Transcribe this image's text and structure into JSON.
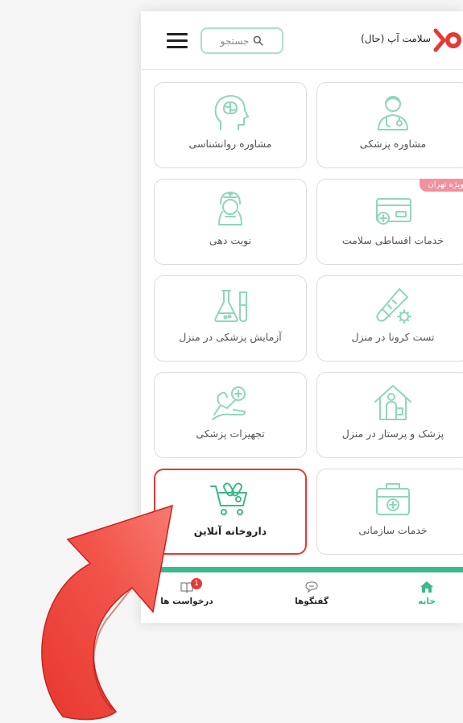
{
  "header": {
    "app_title": "سلامت آپ (حال)",
    "search_placeholder": "جستجو"
  },
  "services": [
    {
      "label": "مشاوره پزشکی",
      "icon": "doctor-icon"
    },
    {
      "label": "مشاوره روانشناسی",
      "icon": "brain-head-icon"
    },
    {
      "label": "خدمات اقساطی سلامت",
      "icon": "credit-card-icon",
      "badge": "ویژه تهران"
    },
    {
      "label": "نوبت دهی",
      "icon": "nurse-icon"
    },
    {
      "label": "تست کرونا در منزل",
      "icon": "test-swab-icon"
    },
    {
      "label": "آزمایش پزشکی در منزل",
      "icon": "lab-flask-icon"
    },
    {
      "label": "پزشک و پرستار در منزل",
      "icon": "home-doctor-icon"
    },
    {
      "label": "تجهیزات پزشکی",
      "icon": "medical-equipment-icon"
    },
    {
      "label": "خدمات سازمانی",
      "icon": "medical-kit-icon"
    },
    {
      "label": "داروخانه آنلاین",
      "icon": "pharmacy-cart-icon",
      "highlighted": true
    }
  ],
  "bottom_nav": [
    {
      "label": "خانه",
      "icon": "home-icon",
      "active": true
    },
    {
      "label": "گفتگوها",
      "icon": "chat-icon"
    },
    {
      "label": "درخواست ها",
      "icon": "requests-icon",
      "badge": "1"
    }
  ],
  "colors": {
    "accent": "#3cb88a",
    "icon_tint": "#8fd6bb",
    "highlight": "#e53935",
    "badge_pink": "#f48fa0"
  }
}
